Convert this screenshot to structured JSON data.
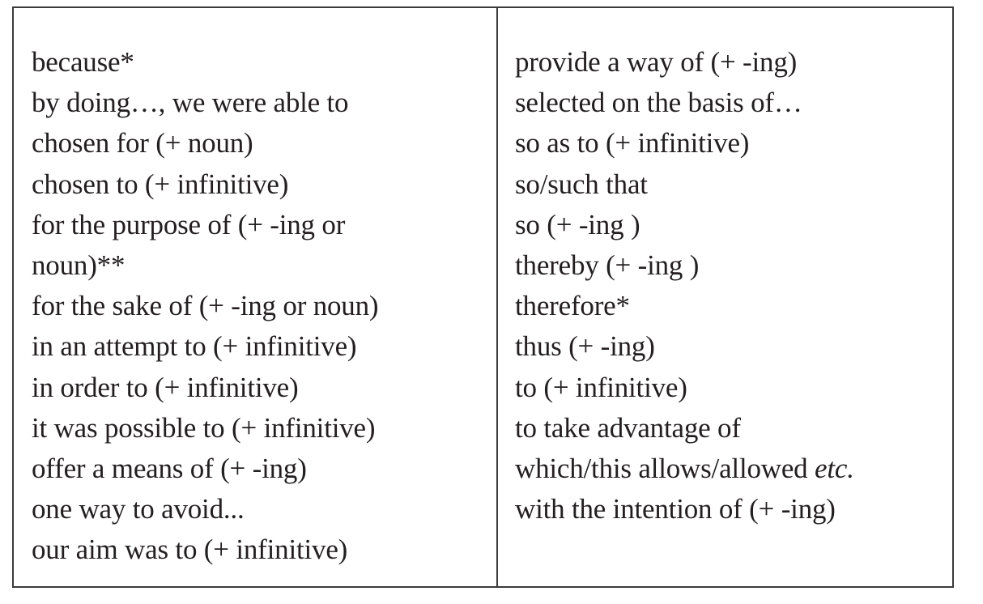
{
  "table": {
    "left_column": [
      {
        "text": "because*"
      },
      {
        "text": "by doing…, we were able to"
      },
      {
        "text": "chosen for (+ noun)"
      },
      {
        "text": "chosen to (+ infinitive)"
      },
      {
        "text": "for the purpose of (+ -ing or"
      },
      {
        "text": "noun)**"
      },
      {
        "text": "for the sake of (+ -ing or noun)"
      },
      {
        "text": "in an attempt to (+ infinitive)"
      },
      {
        "text": "in order to (+ infinitive)"
      },
      {
        "text": "it was possible to (+ infinitive)"
      },
      {
        "text": "offer a means of (+ -ing)"
      },
      {
        "text": "one way to avoid..."
      },
      {
        "text": "our aim was to (+ infinitive)"
      }
    ],
    "right_column": [
      {
        "text": "provide a way of (+ -ing)"
      },
      {
        "text": "selected on the basis of…"
      },
      {
        "text": "so as to (+ infinitive)"
      },
      {
        "text": "so/such that"
      },
      {
        "text": "so (+ -ing )"
      },
      {
        "text": "thereby (+ -ing )"
      },
      {
        "text": "therefore*"
      },
      {
        "text": "thus (+ -ing)"
      },
      {
        "text": "to (+ infinitive)"
      },
      {
        "text": "to take advantage of"
      },
      {
        "text": "which/this allows/allowed ",
        "italic": "etc."
      },
      {
        "text": "with the intention of (+ -ing)"
      }
    ]
  }
}
